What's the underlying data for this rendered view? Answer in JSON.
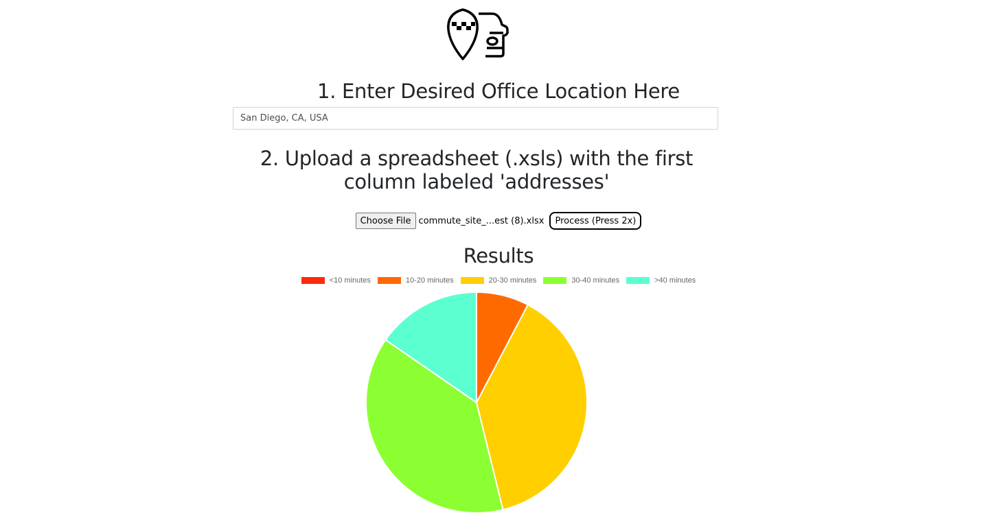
{
  "logo": {
    "icon": "taxi-location-pin-icon"
  },
  "step1": {
    "title": "1. Enter Desired Office Location Here",
    "location_value": "San Diego, CA, USA"
  },
  "step2": {
    "title": "2. Upload a spreadsheet (.xsls) with the first column labeled 'addresses'",
    "choose_label": "Choose File",
    "filename": "commute_site_...est (8).xlsx",
    "process_label": "Process (Press 2x)"
  },
  "results": {
    "title": "Results"
  },
  "chart_data": {
    "type": "pie",
    "categories": [
      "<10 minutes",
      "10-20 minutes",
      "20-30 minutes",
      "30-40 minutes",
      ">40 minutes"
    ],
    "values": [
      0,
      2,
      10,
      10,
      4
    ],
    "colors": [
      "#ff2a0e",
      "#ff6a00",
      "#ffcf00",
      "#8cff33",
      "#5cffd0"
    ],
    "legend_position": "top"
  }
}
